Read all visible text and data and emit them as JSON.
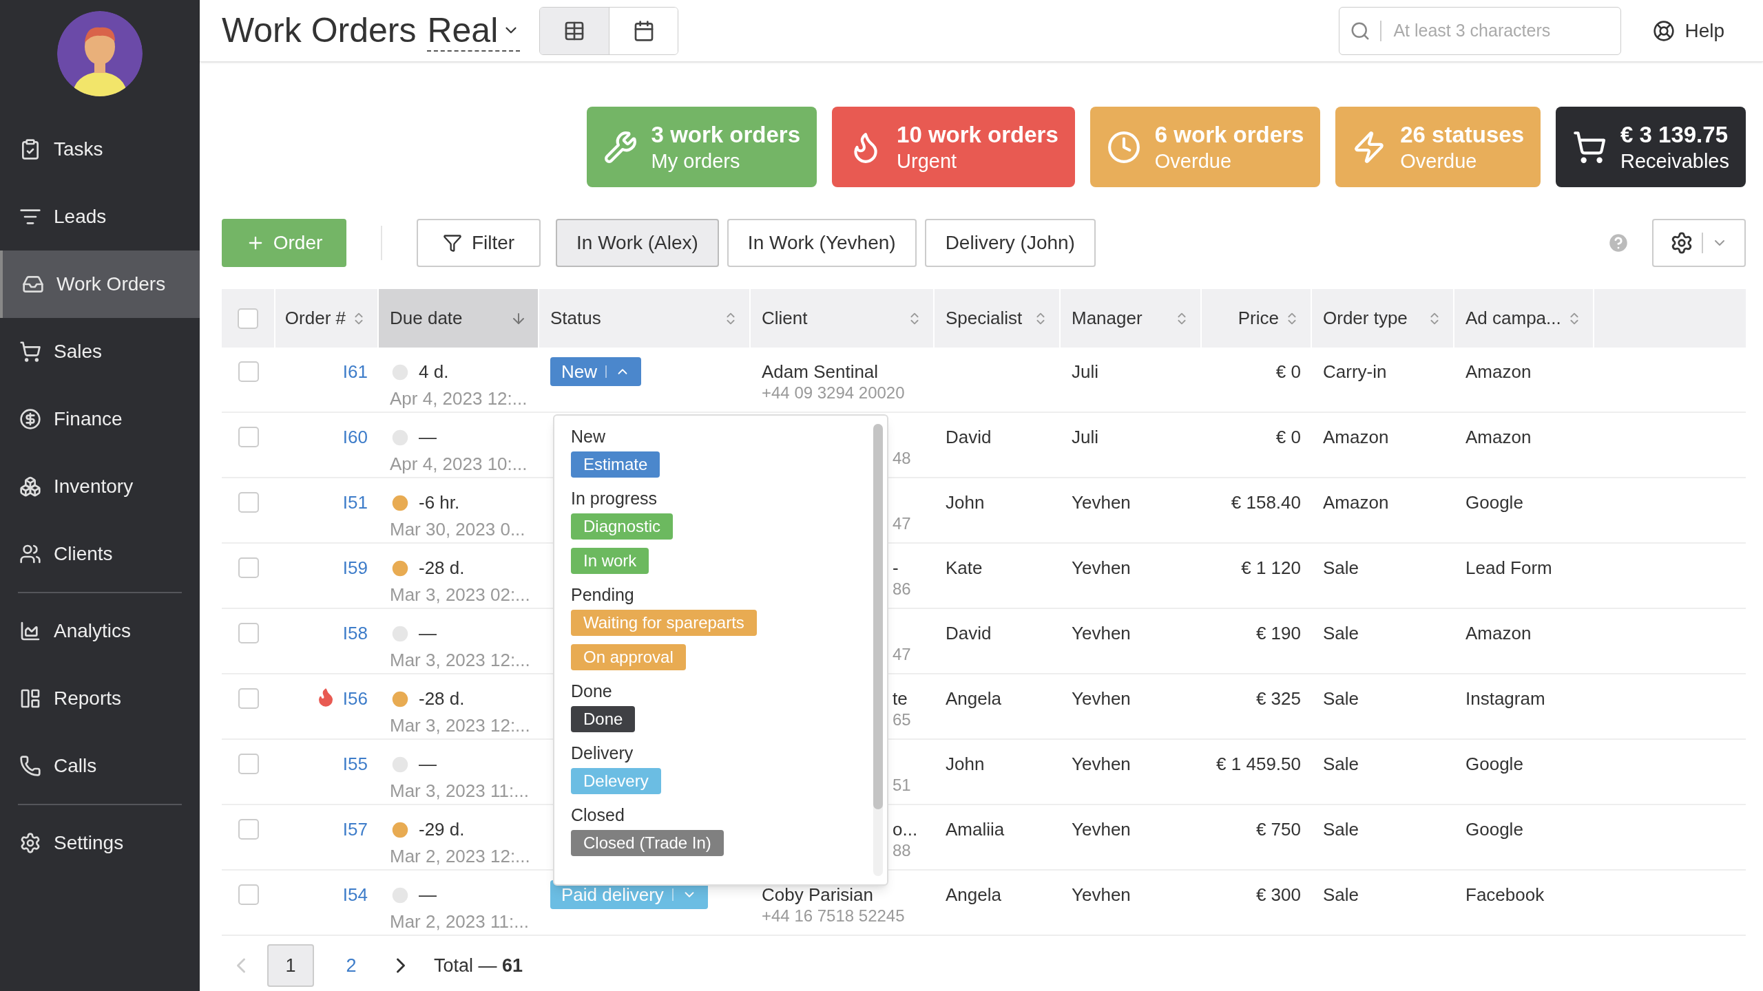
{
  "sidebar": {
    "sections": [
      {
        "items": [
          {
            "label": "Tasks",
            "selected": false
          },
          {
            "label": "Leads",
            "selected": false
          },
          {
            "label": "Work Orders",
            "selected": true
          },
          {
            "label": "Sales",
            "selected": false
          },
          {
            "label": "Finance",
            "selected": false
          },
          {
            "label": "Inventory",
            "selected": false
          },
          {
            "label": "Clients",
            "selected": false
          }
        ]
      },
      {
        "items": [
          {
            "label": "Analytics",
            "selected": false
          },
          {
            "label": "Reports",
            "selected": false
          },
          {
            "label": "Calls",
            "selected": false
          }
        ]
      },
      {
        "items": [
          {
            "label": "Settings",
            "selected": false
          }
        ]
      }
    ]
  },
  "header": {
    "title": "Work Orders",
    "view_name": "Real",
    "views": [
      {
        "selected": true
      },
      {
        "selected": false
      }
    ],
    "search": {
      "placeholder": "At least 3 characters"
    },
    "help": "Help"
  },
  "cards": [
    {
      "color": "#74b566",
      "title": "3 work orders",
      "subtitle": "My orders"
    },
    {
      "color": "#e85a52",
      "title": "10 work orders",
      "subtitle": "Urgent"
    },
    {
      "color": "#e8ae5a",
      "title": "6 work orders",
      "subtitle": "Overdue"
    },
    {
      "color": "#e8ae5a",
      "title": "26 statuses",
      "subtitle": "Overdue"
    },
    {
      "color": "#2b2c30",
      "title": "€ 3 139.75",
      "subtitle": "Receivables"
    }
  ],
  "toolbar": {
    "add_button": "Order",
    "filter_button": "Filter",
    "saved_filters": [
      {
        "label": "In Work (Alex)",
        "selected": true
      },
      {
        "label": "In Work (Yevhen)",
        "selected": false
      },
      {
        "label": "Delivery (John)",
        "selected": false
      }
    ]
  },
  "table": {
    "select_all": {
      "checked": false
    },
    "columns": [
      {
        "label": "Order #",
        "sorted": false
      },
      {
        "label": "Due date",
        "sorted": true
      },
      {
        "label": "Status",
        "sorted": false
      },
      {
        "label": "Client",
        "sorted": false
      },
      {
        "label": "Specialist",
        "sorted": false
      },
      {
        "label": "Manager",
        "sorted": false
      },
      {
        "label": "Price",
        "sorted": false
      },
      {
        "label": "Order type",
        "sorted": false
      },
      {
        "label": "Ad campa...",
        "sorted": false
      }
    ],
    "rows": [
      {
        "checked": false,
        "urgent": false,
        "order": "I61",
        "overdue": false,
        "due": "4 d.",
        "date": "Apr 4, 2023 12:...",
        "status": {
          "label": "New",
          "color": "#4b87cc",
          "open": true
        },
        "client": {
          "name": "Adam Sentinal",
          "phone": "+44 09 3294 20020"
        },
        "specialist": "",
        "manager": "Juli",
        "price": "€ 0",
        "order_type": "Carry-in",
        "ad_campaign": "Amazon"
      },
      {
        "checked": false,
        "urgent": false,
        "order": "I60",
        "overdue": false,
        "due": "—",
        "date": "Apr 4, 2023 10:...",
        "client": {
          "phone": "48"
        },
        "specialist": "David",
        "manager": "Juli",
        "price": "€ 0",
        "order_type": "Amazon",
        "ad_campaign": "Amazon"
      },
      {
        "checked": false,
        "urgent": false,
        "order": "I51",
        "overdue": true,
        "due": "-6 hr.",
        "date": "Mar 30, 2023 0...",
        "client": {
          "phone": "47"
        },
        "specialist": "John",
        "manager": "Yevhen",
        "price": "€ 158.40",
        "order_type": "Amazon",
        "ad_campaign": "Google"
      },
      {
        "checked": false,
        "urgent": false,
        "order": "I59",
        "overdue": true,
        "due": "-28 d.",
        "date": "Mar 3, 2023 02:...",
        "client": {
          "name": "-",
          "phone": "86"
        },
        "specialist": "Kate",
        "manager": "Yevhen",
        "price": "€ 1 120",
        "order_type": "Sale",
        "ad_campaign": "Lead Form"
      },
      {
        "checked": false,
        "urgent": false,
        "order": "I58",
        "overdue": false,
        "due": "—",
        "date": "Mar 3, 2023 12:...",
        "client": {
          "phone": "47"
        },
        "specialist": "David",
        "manager": "Yevhen",
        "price": "€ 190",
        "order_type": "Sale",
        "ad_campaign": "Amazon"
      },
      {
        "checked": false,
        "urgent": true,
        "order": "I56",
        "overdue": true,
        "due": "-28 d.",
        "date": "Mar 3, 2023 12:...",
        "client": {
          "name": "te",
          "phone": "65"
        },
        "specialist": "Angela",
        "manager": "Yevhen",
        "price": "€ 325",
        "order_type": "Sale",
        "ad_campaign": "Instagram"
      },
      {
        "checked": false,
        "urgent": false,
        "order": "I55",
        "overdue": false,
        "due": "—",
        "date": "Mar 3, 2023 11:...",
        "client": {
          "phone": "51"
        },
        "specialist": "John",
        "manager": "Yevhen",
        "price": "€ 1 459.50",
        "order_type": "Sale",
        "ad_campaign": "Google"
      },
      {
        "checked": false,
        "urgent": false,
        "order": "I57",
        "overdue": true,
        "due": "-29 d.",
        "date": "Mar 2, 2023 12:...",
        "client": {
          "name": "o...",
          "phone": "88"
        },
        "specialist": "Amaliia",
        "manager": "Yevhen",
        "price": "€ 750",
        "order_type": "Sale",
        "ad_campaign": "Google"
      },
      {
        "checked": false,
        "urgent": false,
        "order": "I54",
        "overdue": false,
        "due": "—",
        "date": "Mar 2, 2023 11:...",
        "status": {
          "label": "Paid delivery",
          "color": "#6bbde3",
          "open": false
        },
        "client": {
          "name": "Coby Parisian",
          "phone": "+44 16 7518 52245"
        },
        "specialist": "Angela",
        "manager": "Yevhen",
        "price": "€ 300",
        "order_type": "Sale",
        "ad_campaign": "Facebook"
      }
    ]
  },
  "status_menu": {
    "groups": [
      {
        "label": "New",
        "options": [
          {
            "label": "Estimate",
            "color": "#4b87cc"
          }
        ]
      },
      {
        "label": "In progress",
        "options": [
          {
            "label": "Diagnostic",
            "color": "#6cb95f"
          },
          {
            "label": "In work",
            "color": "#6cb95f"
          }
        ]
      },
      {
        "label": "Pending",
        "options": [
          {
            "label": "Waiting for spareparts",
            "color": "#e8ab52"
          },
          {
            "label": "On approval",
            "color": "#e8ab52"
          }
        ]
      },
      {
        "label": "Done",
        "options": [
          {
            "label": "Done",
            "color": "#3f4044"
          }
        ]
      },
      {
        "label": "Delivery",
        "options": [
          {
            "label": "Delevery",
            "color": "#6bbde3"
          }
        ]
      },
      {
        "label": "Closed",
        "options": [
          {
            "label": "Closed (Trade In)",
            "color": "#808080"
          }
        ]
      }
    ]
  },
  "pagination": {
    "prev_disabled": true,
    "pages": [
      {
        "label": "1",
        "selected": true
      },
      {
        "label": "2",
        "selected": false
      }
    ],
    "total": "Total — **61**"
  }
}
